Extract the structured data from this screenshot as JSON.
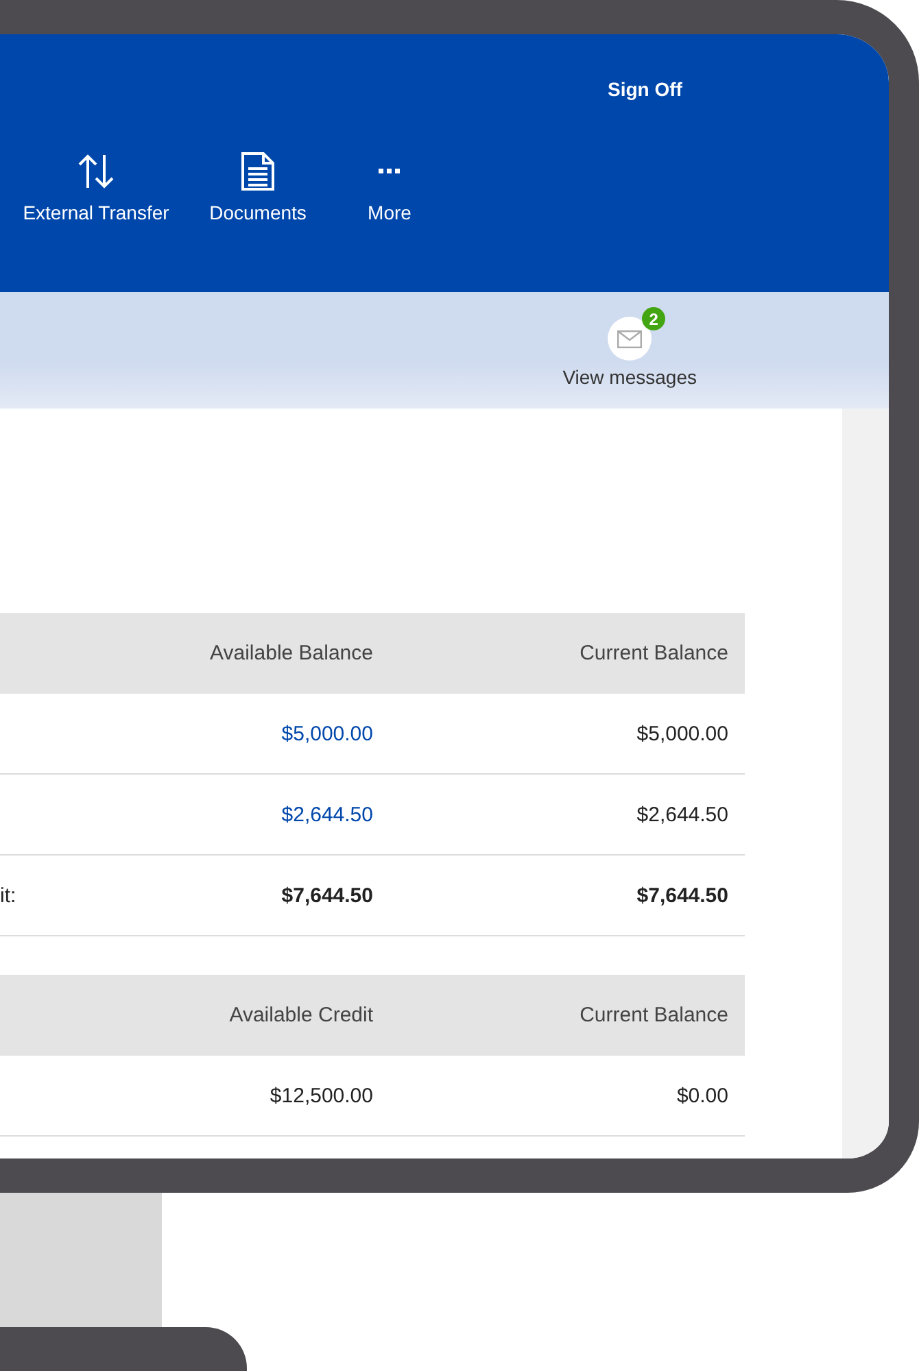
{
  "header": {
    "sign_off": "Sign Off",
    "nav": [
      {
        "kind": "transfer",
        "label": "External Transfer"
      },
      {
        "kind": "documents",
        "label": "Documents"
      },
      {
        "kind": "more",
        "label": "More"
      }
    ]
  },
  "messages": {
    "label": "View messages",
    "badge": "2"
  },
  "deposit_table": {
    "columns": [
      "Available Balance",
      "Current Balance"
    ],
    "rows": [
      {
        "kind": "linked",
        "available": "$5,000.00",
        "current": "$5,000.00"
      },
      {
        "kind": "linked",
        "available": "$2,644.50",
        "current": "$2,644.50"
      },
      {
        "kind": "total",
        "label": "it:",
        "available": "$7,644.50",
        "current": "$7,644.50"
      }
    ]
  },
  "credit_table": {
    "columns": [
      "Available Credit",
      "Current Balance"
    ],
    "rows": [
      {
        "kind": "plain",
        "available": "$12,500.00",
        "current": "$0.00"
      }
    ]
  }
}
